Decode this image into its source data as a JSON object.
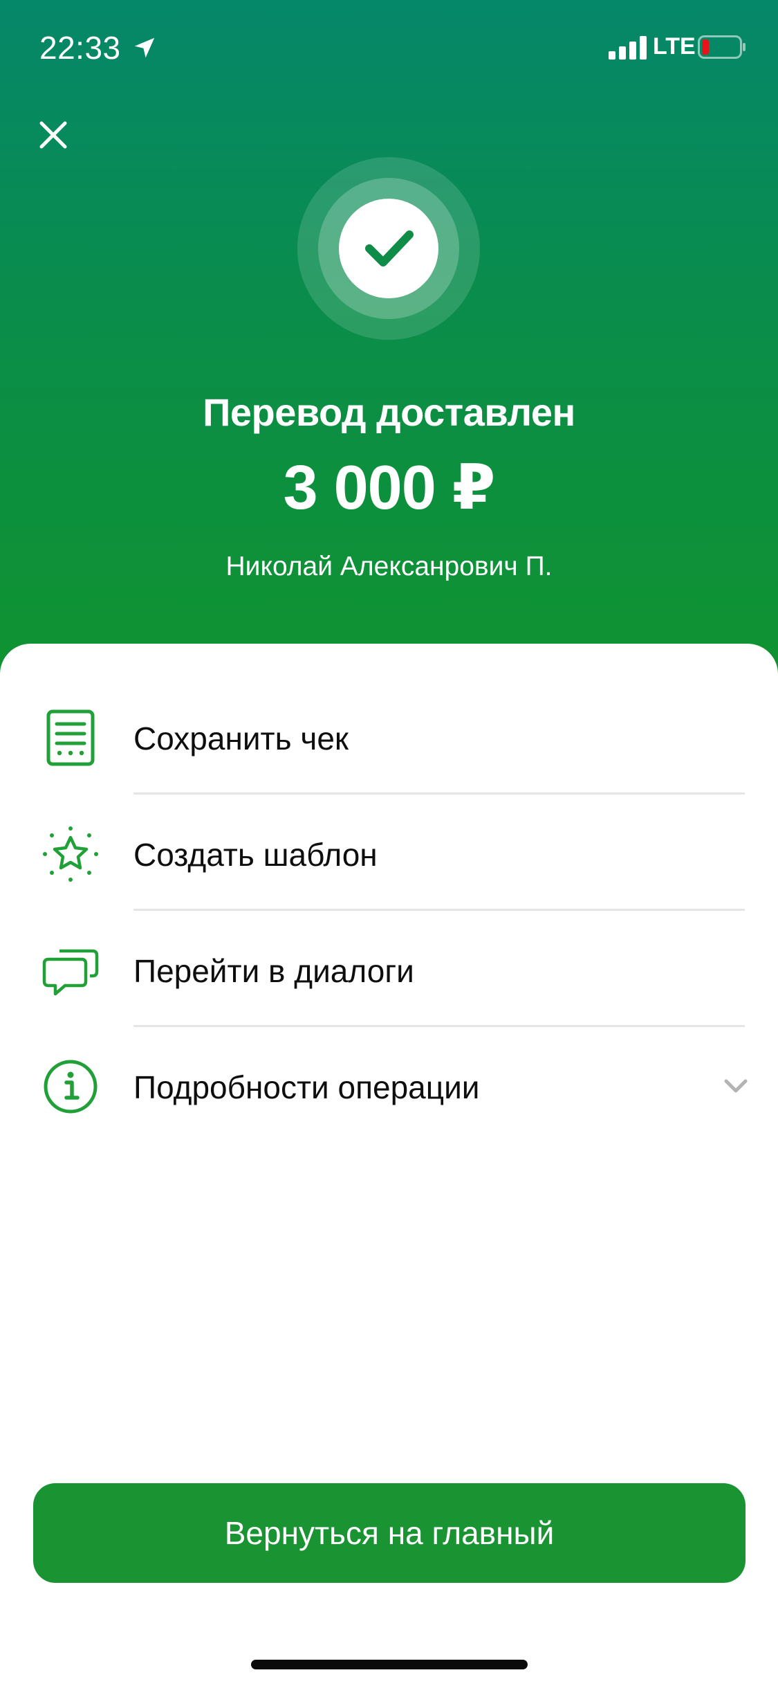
{
  "status_bar": {
    "time": "22:33",
    "network": "LTE",
    "icons": [
      "location-arrow-icon",
      "signal-icon",
      "battery-icon"
    ]
  },
  "header": {
    "title": "Перевод доставлен",
    "amount": "3 000 ₽",
    "recipient": "Николай Алексанрович П.",
    "icons": [
      "close-icon",
      "success-check-icon"
    ]
  },
  "actions": [
    {
      "label": "Сохранить чек",
      "icon": "receipt-icon"
    },
    {
      "label": "Создать шаблон",
      "icon": "star-icon"
    },
    {
      "label": "Перейти в диалоги",
      "icon": "chat-icon"
    },
    {
      "label": "Подробности операции",
      "icon": "info-icon",
      "trailing_icon": "chevron-down-icon"
    }
  ],
  "footer": {
    "button_label": "Вернуться на главный"
  },
  "colors": {
    "header_gradient_top": "#05876a",
    "header_gradient_bottom": "#10932f",
    "accent_green": "#1a9432",
    "icon_green": "#21a038"
  }
}
